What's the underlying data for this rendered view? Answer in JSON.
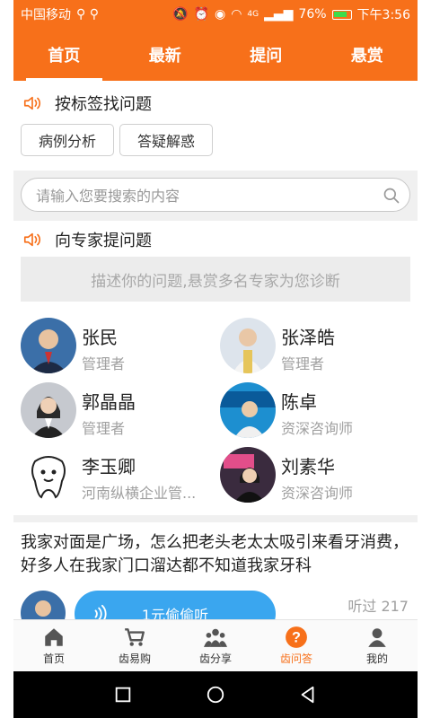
{
  "status": {
    "carrier": "中国移动",
    "battery": "76%",
    "time": "下午3:56",
    "network": "4G"
  },
  "tabs": [
    {
      "label": "首页",
      "active": true
    },
    {
      "label": "最新",
      "active": false
    },
    {
      "label": "提问",
      "active": false
    },
    {
      "label": "悬赏",
      "active": false
    }
  ],
  "tags_section": {
    "title": "按标签找问题",
    "tags": [
      "病例分析",
      "答疑解惑"
    ]
  },
  "search": {
    "placeholder": "请输入您要搜索的内容"
  },
  "ask_section": {
    "title": "向专家提问题",
    "prompt": "描述你的问题,悬赏多名专家为您诊断"
  },
  "experts": [
    {
      "name": "张民",
      "role": "管理者"
    },
    {
      "name": "张泽皓",
      "role": "管理者"
    },
    {
      "name": "郭晶晶",
      "role": "管理者"
    },
    {
      "name": "陈卓",
      "role": "资深咨询师"
    },
    {
      "name": "李玉卿",
      "role": "河南纵横企业管..."
    },
    {
      "name": "刘素华",
      "role": "资深咨询师"
    }
  ],
  "question": {
    "text": "我家对面是广场，怎么把老头老太太吸引来看牙消费，好多人在我家门口溜达都不知道我家牙科",
    "listen_label": "1元偷偷听",
    "listen_count": "听过 217"
  },
  "bottom_nav": [
    {
      "label": "首页",
      "icon": "home-icon",
      "active": false
    },
    {
      "label": "齿易购",
      "icon": "cart-icon",
      "active": false
    },
    {
      "label": "齿分享",
      "icon": "group-icon",
      "active": false
    },
    {
      "label": "齿问答",
      "icon": "question-icon",
      "active": true
    },
    {
      "label": "我的",
      "icon": "person-icon",
      "active": false
    }
  ],
  "colors": {
    "accent": "#f7701a",
    "listen": "#3aa6ef"
  }
}
